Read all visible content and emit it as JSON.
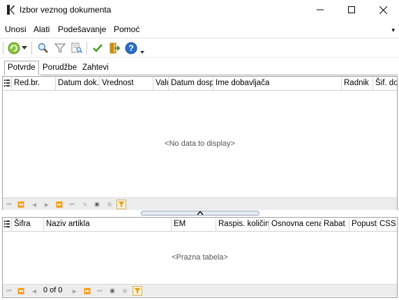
{
  "window": {
    "title": "Izbor veznog dokumenta",
    "minimize": "—",
    "maximize": "☐",
    "close": "✕"
  },
  "menu": [
    "Unosi",
    "Alati",
    "Podešavanje",
    "Pomoć"
  ],
  "menu_overflow": "▾",
  "toolbar": {
    "icons": [
      "refresh-icon",
      "dropdown-arrow-icon",
      "search-icon",
      "filter-icon",
      "preview-icon",
      "check-icon",
      "exit-icon",
      "help-icon",
      "dropdown-arrow-icon"
    ]
  },
  "tabs": [
    {
      "label": "Potvrde",
      "active": true
    },
    {
      "label": "Porudžbe",
      "active": false
    },
    {
      "label": "Zahtevi",
      "active": false
    }
  ],
  "top_grid": {
    "columns": [
      "Red.br.",
      "Datum dok.",
      "Vrednost",
      "Valu",
      "Datum dosp",
      "Ime dobavljača",
      "Radnik",
      "Šif. do"
    ],
    "empty_text": "<No data to display>"
  },
  "bottom_grid": {
    "columns": [
      "Šifra",
      "Naziv artikla",
      "EM",
      "Raspis. količina",
      "Osnovna cena",
      "Rabat",
      "Popust",
      "CSS"
    ],
    "empty_text": "<Prazna tabela>",
    "record_counter": "0 of 0"
  },
  "colors": {
    "filter_accent": "#e0a000",
    "check": "#4aa02c",
    "help": "#2a6fc9"
  }
}
